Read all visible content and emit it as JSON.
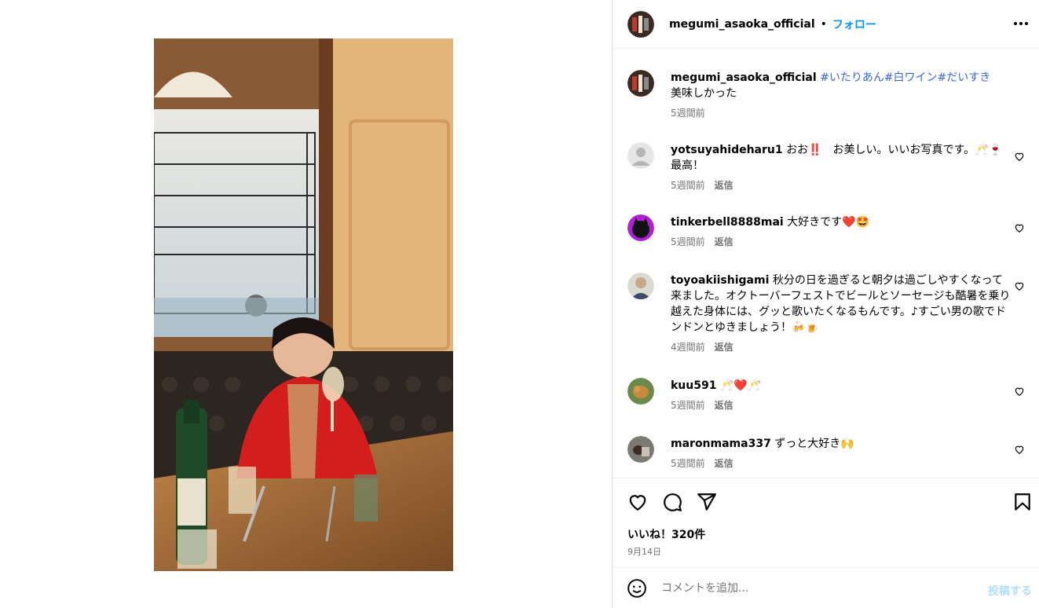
{
  "post": {
    "username": "megumi_asaoka_official",
    "separator": "•",
    "follow_label": "フォロー"
  },
  "caption": {
    "username": "megumi_asaoka_official",
    "hashtags": "#いたりあん#白ワイン#だいすき",
    "text": "美味しかった",
    "time": "5週間前"
  },
  "comments": [
    {
      "username": "yotsuyahideharu1",
      "text": "おお‼️　お美しい。いいお写真です。🥂🍷最高！",
      "time": "5週間前",
      "reply": "返信"
    },
    {
      "username": "tinkerbell8888mai",
      "text": "大好きです❤️🤩",
      "time": "5週間前",
      "reply": "返信"
    },
    {
      "username": "toyoakiishigami",
      "text": "秋分の日を過ぎると朝夕は過ごしやすくなって来ました。オクトーバーフェストでビールとソーセージも酷暑を乗り越えた身体には、グッと歌いたくなるもんです。♪すごい男の歌でドンドンとゆきましょう！🍻🍺",
      "time": "4週間前",
      "reply": "返信"
    },
    {
      "username": "kuu591",
      "text": "🥂❤️🥂",
      "time": "5週間前",
      "reply": "返信"
    },
    {
      "username": "maronmama337",
      "text": "ずっと大好き🙌",
      "time": "5週間前",
      "reply": "返信"
    }
  ],
  "footer": {
    "likes": "いいね！320件",
    "date": "9月14日",
    "comment_placeholder": "コメントを追加...",
    "post_label": "投稿する"
  },
  "icons": [
    "more-icon",
    "heart-icon",
    "comment-icon",
    "share-icon",
    "bookmark-icon",
    "emoji-icon"
  ],
  "colors": {
    "accent": "#0095f6",
    "hashtag": "#3b68d8",
    "muted": "#737373",
    "post_disabled": "#b2dffc"
  }
}
